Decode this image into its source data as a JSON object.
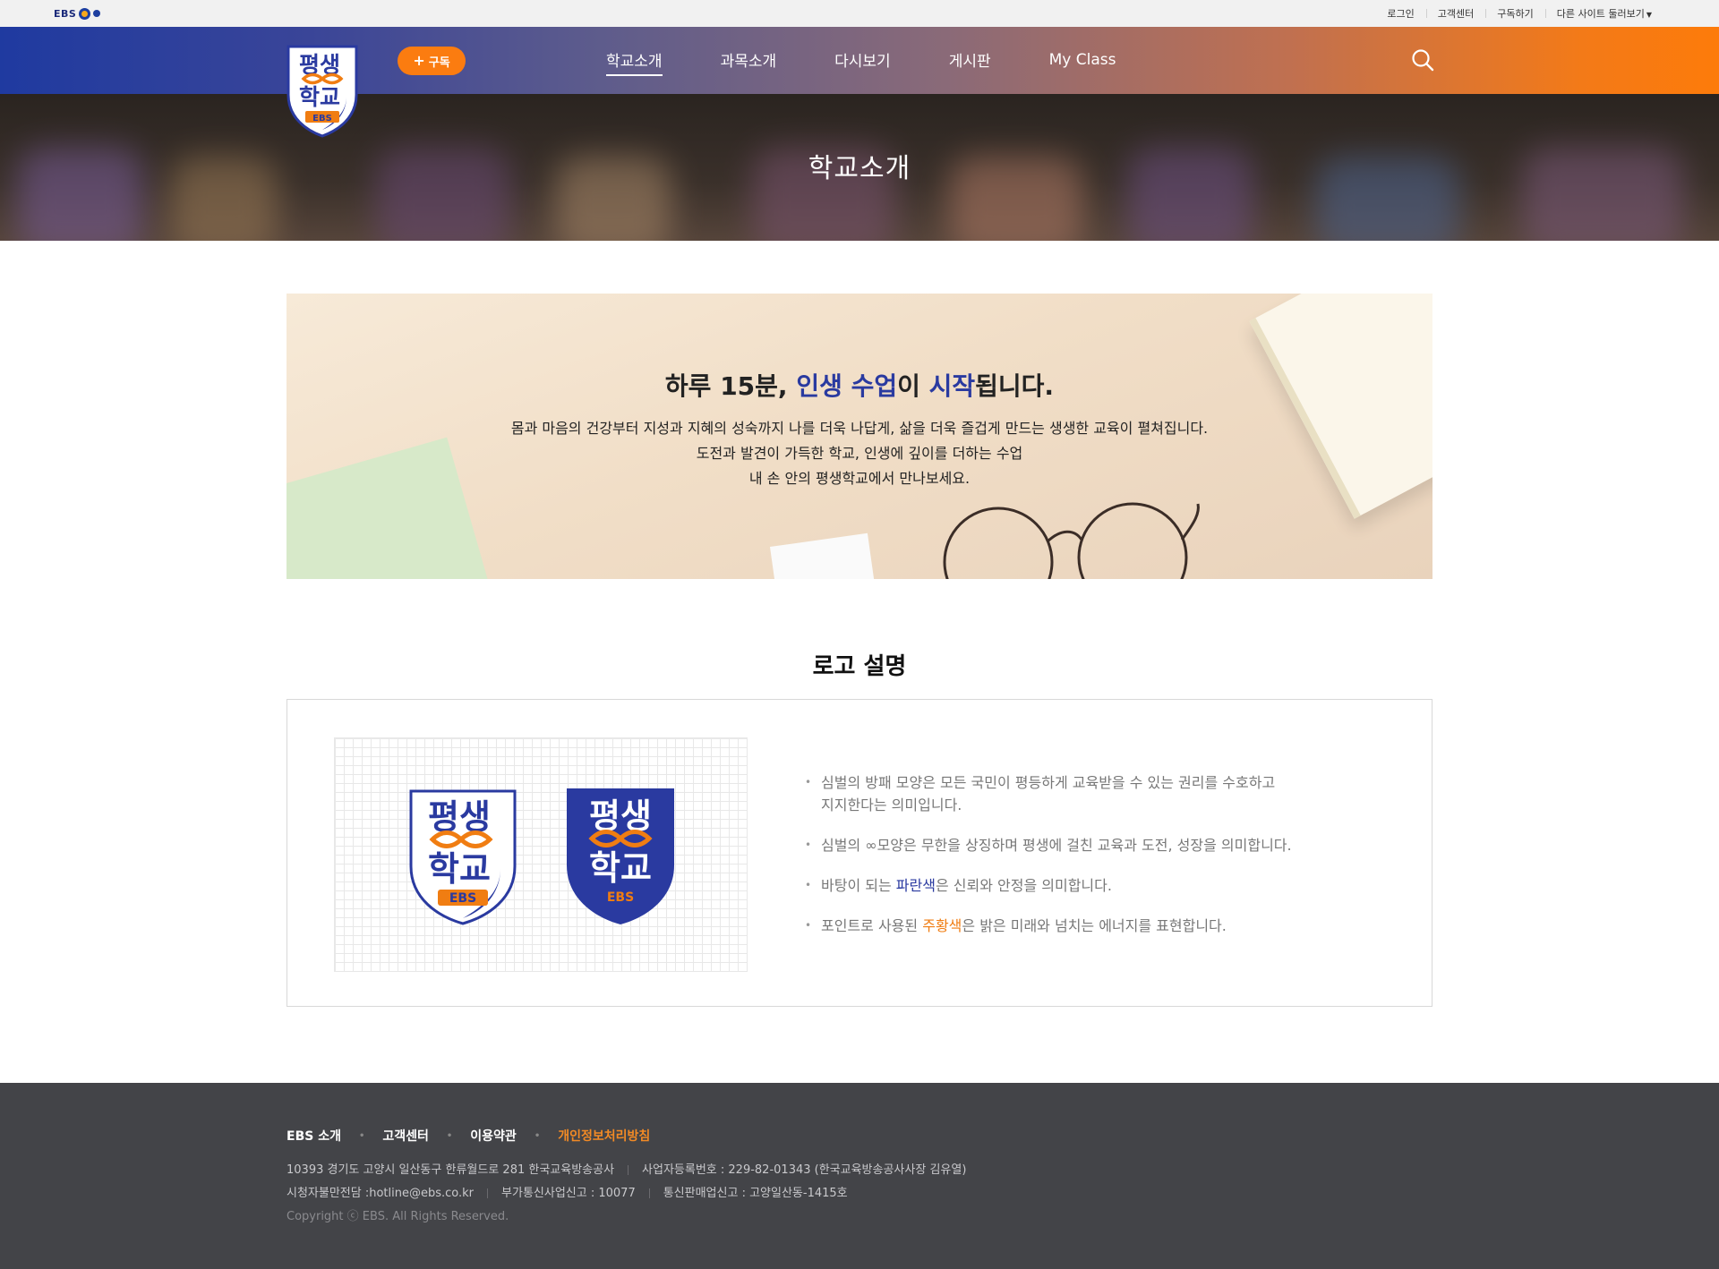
{
  "util_bar": {
    "ebs_logo": "EBS",
    "links": [
      "로그인",
      "고객센터",
      "구독하기",
      "다른 사이트 둘러보기"
    ]
  },
  "header": {
    "site_logo": {
      "line1": "평생",
      "line2": "학교",
      "line3": "EBS"
    },
    "subscribe_label": "구독",
    "nav": [
      "학교소개",
      "과목소개",
      "다시보기",
      "게시판",
      "My Class"
    ],
    "active_nav": "학교소개",
    "search_icon": "search-icon"
  },
  "hero": {
    "title": "학교소개"
  },
  "intro": {
    "heading_parts": [
      "하루 15분, ",
      "인생 수업",
      "이 ",
      "시작",
      "됩니다."
    ],
    "lines": [
      "몸과 마음의 건강부터 지성과 지혜의 성숙까지 나를 더욱 나답게, 삶을 더욱 즐겁게 만드는 생생한 교육이 펼쳐집니다.",
      "도전과 발견이 가득한 학교, 인생에 깊이를 더하는 수업",
      "내 손 안의 평생학교에서 만나보세요."
    ]
  },
  "logo_section": {
    "title": "로고 설명",
    "descriptions": [
      {
        "text1": "심벌의 방패 모양은 모든 국민이 평등하게 교육받을 수 있는 권리를 수호하고",
        "text2": "지지한다는 의미입니다."
      },
      {
        "text": "심벌의 ∞모양은 무한을 상징하며 평생에 걸친 교육과 도전, 성장을 의미합니다."
      },
      {
        "pre": "바탕이 되는 ",
        "highlight": "파란색",
        "post": "은 신뢰와 안정을 의미합니다."
      },
      {
        "pre": "포인트로 사용된 ",
        "highlight": "주황색",
        "post": "은 밝은 미래와 넘치는 에너지를 표현합니다."
      }
    ]
  },
  "footer": {
    "links": [
      "EBS 소개",
      "고객센터",
      "이용약관",
      "개인정보처리방침"
    ],
    "address": "10393 경기도 고양시 일산동구 한류월드로 281 한국교육방송공사",
    "business_no": "사업자등록번호 : 229-82-01343 (한국교육방송공사사장 김유열)",
    "hotline": "시청자불만전담 :hotline@ebs.co.kr",
    "vas": "부가통신사업신고 : 10077",
    "ecommerce": "통신판매업신고 : 고양일산동-1415호",
    "copyright": "Copyright ⓒ EBS. All Rights Reserved."
  },
  "colors": {
    "brand_blue": "#2a3aa0",
    "brand_orange": "#f07d12",
    "footer_bg": "#434448"
  }
}
